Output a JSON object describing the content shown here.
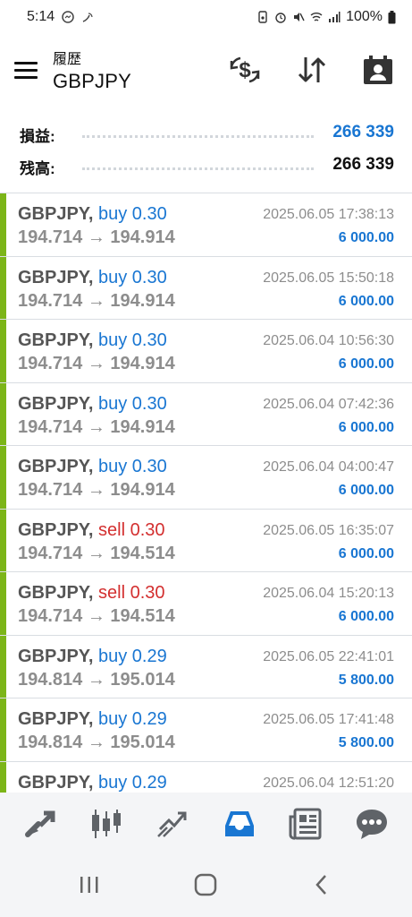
{
  "status_bar": {
    "time": "5:14",
    "battery": "100%"
  },
  "header": {
    "subtitle": "履歴",
    "title": "GBPJPY"
  },
  "summary": {
    "profit_label": "損益:",
    "profit_value": "266 339",
    "balance_label": "残高:",
    "balance_value": "266 339"
  },
  "deals": [
    {
      "symbol": "GBPJPY,",
      "side": "buy",
      "side_text": "buy 0.30",
      "prices": "194.714 → 194.914",
      "time": "2025.06.05 17:38:13",
      "profit": "6 000.00"
    },
    {
      "symbol": "GBPJPY,",
      "side": "buy",
      "side_text": "buy 0.30",
      "prices": "194.714 → 194.914",
      "time": "2025.06.05 15:50:18",
      "profit": "6 000.00"
    },
    {
      "symbol": "GBPJPY,",
      "side": "buy",
      "side_text": "buy 0.30",
      "prices": "194.714 → 194.914",
      "time": "2025.06.04 10:56:30",
      "profit": "6 000.00"
    },
    {
      "symbol": "GBPJPY,",
      "side": "buy",
      "side_text": "buy 0.30",
      "prices": "194.714 → 194.914",
      "time": "2025.06.04 07:42:36",
      "profit": "6 000.00"
    },
    {
      "symbol": "GBPJPY,",
      "side": "buy",
      "side_text": "buy 0.30",
      "prices": "194.714 → 194.914",
      "time": "2025.06.04 04:00:47",
      "profit": "6 000.00"
    },
    {
      "symbol": "GBPJPY,",
      "side": "sell",
      "side_text": "sell 0.30",
      "prices": "194.714 → 194.514",
      "time": "2025.06.05 16:35:07",
      "profit": "6 000.00"
    },
    {
      "symbol": "GBPJPY,",
      "side": "sell",
      "side_text": "sell 0.30",
      "prices": "194.714 → 194.514",
      "time": "2025.06.04 15:20:13",
      "profit": "6 000.00"
    },
    {
      "symbol": "GBPJPY,",
      "side": "buy",
      "side_text": "buy 0.29",
      "prices": "194.814 → 195.014",
      "time": "2025.06.05 22:41:01",
      "profit": "5 800.00"
    },
    {
      "symbol": "GBPJPY,",
      "side": "buy",
      "side_text": "buy 0.29",
      "prices": "194.814 → 195.014",
      "time": "2025.06.05 17:41:48",
      "profit": "5 800.00"
    },
    {
      "symbol": "GBPJPY,",
      "side": "buy",
      "side_text": "buy 0.29",
      "prices": "",
      "time": "2025.06.04 12:51:20",
      "profit": ""
    }
  ],
  "bottom_nav": [
    {
      "name": "quotes-icon",
      "active": false
    },
    {
      "name": "chart-icon",
      "active": false
    },
    {
      "name": "trade-icon",
      "active": false
    },
    {
      "name": "history-icon",
      "active": true
    },
    {
      "name": "news-icon",
      "active": false
    },
    {
      "name": "messages-icon",
      "active": false
    }
  ],
  "colors": {
    "accent": "#1976d2",
    "buy": "#1976d2",
    "sell": "#d32f2f",
    "profit_bar": "#7cb518",
    "icon_gray": "#5f6368"
  }
}
